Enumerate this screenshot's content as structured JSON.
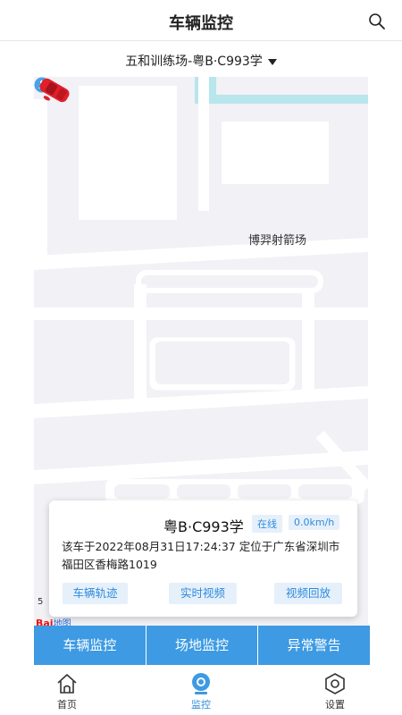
{
  "header": {
    "title": "车辆监控",
    "search_icon": "search-icon"
  },
  "selector": {
    "value": "五和训练场-粤B·C993学"
  },
  "map": {
    "poi_label": "博羿射箭场",
    "scale_text": "5",
    "brand_baidu": "Bai",
    "brand_map": "地图"
  },
  "card": {
    "plate": "粤B·C993学",
    "status": "在线",
    "speed": "0.0km/h",
    "description": "该车于2022年08月31日17:24:37 定位于广东省深圳市福田区香梅路1019",
    "buttons": {
      "track": "车辆轨迹",
      "live": "实时视频",
      "playback": "视频回放"
    }
  },
  "bluebar": {
    "tabs": [
      "车辆监控",
      "场地监控",
      "异常警告"
    ]
  },
  "bottomnav": {
    "items": [
      {
        "label": "首页",
        "icon": "home-icon"
      },
      {
        "label": "监控",
        "icon": "monitor-icon"
      },
      {
        "label": "设置",
        "icon": "settings-icon"
      }
    ],
    "active_color": "#2f8bdc"
  },
  "colors": {
    "accent": "#3d9ae3",
    "car": "#e0202a",
    "map_bg": "#f1f1f6"
  }
}
